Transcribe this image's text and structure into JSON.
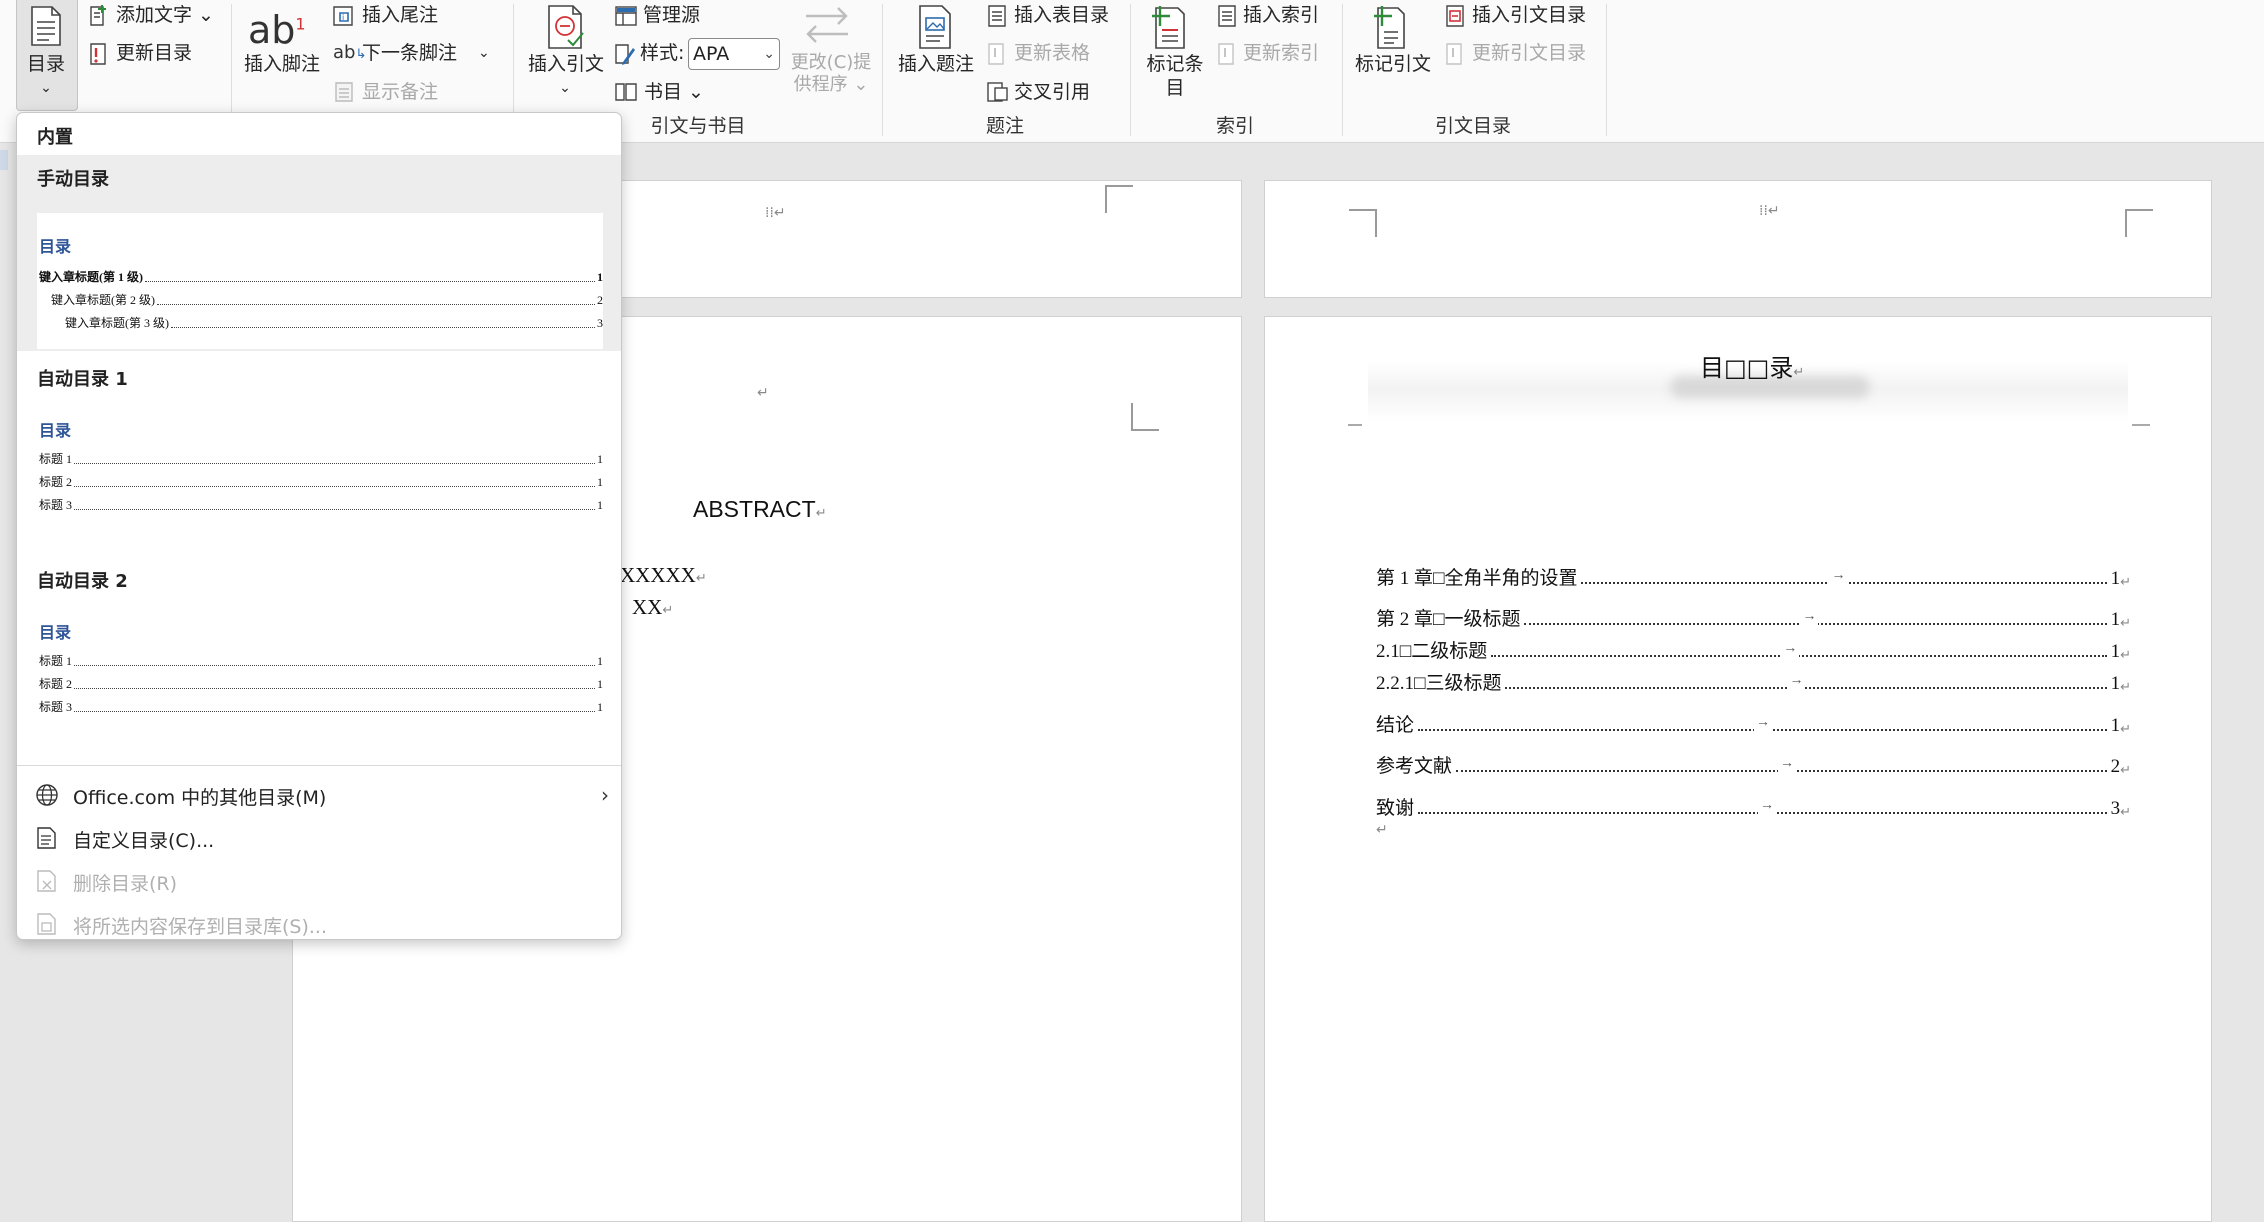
{
  "ribbon": {
    "toc_group": {
      "toc_label": "目录",
      "add_text": "添加文字",
      "update_toc": "更新目录"
    },
    "footnotes": {
      "insert_footnote": "插入脚注",
      "insert_endnote": "插入尾注",
      "next_footnote": "下一条脚注",
      "show_notes": "显示备注",
      "ab_glyph": "ab",
      "sup_glyph": "1"
    },
    "citations": {
      "insert_citation": "插入引文",
      "manage_sources": "管理源",
      "style_label": "样式:",
      "style_value": "APA",
      "bibliography": "书目",
      "change_provider": "更改(C)提供程序",
      "group_label": "引文与书目"
    },
    "captions": {
      "insert_caption": "插入题注",
      "insert_table_of_figures": "插入表目录",
      "update_table": "更新表格",
      "cross_reference": "交叉引用",
      "group_label": "题注"
    },
    "index": {
      "mark_entry": "标记条目",
      "insert_index": "插入索引",
      "update_index": "更新索引",
      "group_label": "索引"
    },
    "toa": {
      "mark_citation": "标记引文",
      "insert_toa": "插入引文目录",
      "update_toa": "更新引文目录",
      "group_label": "引文目录"
    }
  },
  "gallery": {
    "section_builtin": "内置",
    "manual": {
      "name": "手动目录",
      "preview_title": "目录",
      "lines": [
        {
          "text": "键入章标题(第 1 级)",
          "page": "1"
        },
        {
          "text": "键入章标题(第 2 级)",
          "page": "2"
        },
        {
          "text": "键入章标题(第 3 级)",
          "page": "3"
        }
      ]
    },
    "auto1": {
      "name": "自动目录 1",
      "preview_title": "目录",
      "lines": [
        {
          "text": "标题 1",
          "page": "1"
        },
        {
          "text": "标题 2",
          "page": "1"
        },
        {
          "text": "标题 3",
          "page": "1"
        }
      ]
    },
    "auto2": {
      "name": "自动目录 2",
      "preview_title": "目录",
      "lines": [
        {
          "text": "标题 1",
          "page": "1"
        },
        {
          "text": "标题 2",
          "page": "1"
        },
        {
          "text": "标题 3",
          "page": "1"
        }
      ]
    },
    "menu": {
      "more_office": "Office.com 中的其他目录(M)",
      "custom": "自定义目录(C)...",
      "remove": "删除目录(R)",
      "save_selection": "将所选内容保存到目录库(S)..."
    }
  },
  "document": {
    "abstract_title": "ABSTRACT",
    "abstract_line1": "XXXXX",
    "abstract_line2": "XX",
    "toc_title": "目□□录",
    "toc_entries": [
      {
        "text": "第 1 章□全角半角的设置",
        "page": "1"
      },
      {
        "text": "第 2 章□一级标题",
        "page": "1"
      },
      {
        "text": "2.1□二级标题",
        "page": "1"
      },
      {
        "text": "2.2.1□三级标题",
        "page": "1"
      },
      {
        "text": "结论",
        "page": "1"
      },
      {
        "text": "参考文献",
        "page": "2"
      },
      {
        "text": "致谢",
        "page": "3"
      }
    ]
  }
}
